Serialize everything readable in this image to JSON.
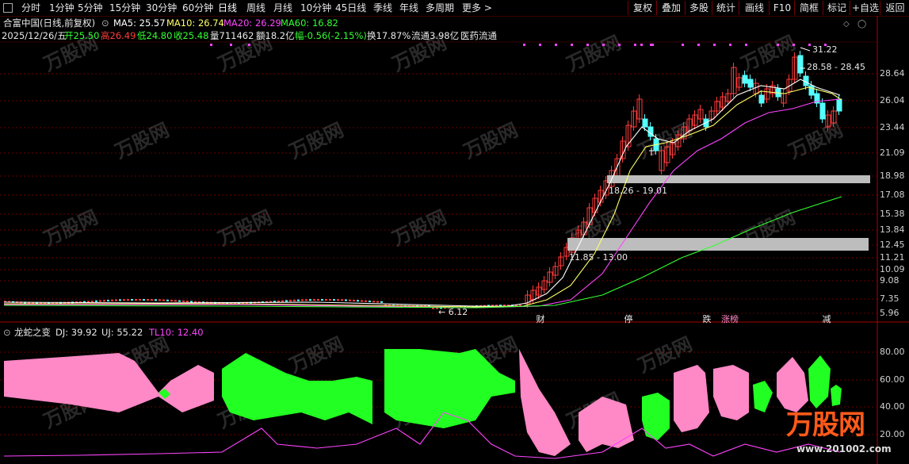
{
  "toolbar": {
    "left_items": [
      "分时",
      "1分钟",
      "5分钟",
      "15分钟",
      "30分钟",
      "60分钟",
      "日线",
      "周线",
      "月线",
      "10分钟",
      "45日线",
      "季线",
      "年线",
      "多周期",
      "更多 >"
    ],
    "active_item": "日线",
    "right_items": [
      "复权",
      "叠加",
      "多股",
      "统计",
      "画线",
      "F10",
      "简框",
      "标记",
      "+自选",
      "返回"
    ]
  },
  "stock": {
    "name_line": "合富中国(日线,前复权)",
    "ma5": "MA5: 25.57",
    "ma10": "MA10: 26.74",
    "ma20": "MA20: 26.29",
    "ma60": "MA60: 16.82",
    "date": "2025/12/26/五",
    "open": "开25.50",
    "high": "高26.49",
    "low": "低24.80",
    "close": "收25.48",
    "volume": "量711462",
    "amount": "额18.2亿",
    "change": "幅-0.56(-2.15%)",
    "turnover": "换17.87%",
    "float": "流通3.98亿",
    "sector": "医药流通"
  },
  "annotations": {
    "peak": "31.22",
    "range_top": "28.58 - 28.45",
    "box_upper": "18.26 - 19.01",
    "box_lower": "11.85 - 13.00",
    "low_mark": "← 6.12"
  },
  "events": [
    "财",
    "停",
    "跌",
    "涨榜",
    "减"
  ],
  "main_axis": [
    "28.64",
    "26.04",
    "23.44",
    "21.09",
    "18.98",
    "17.08",
    "15.38",
    "13.84",
    "12.45",
    "11.21",
    "10.09",
    "9.08",
    "7.35",
    "5.96"
  ],
  "indicator": {
    "name": "龙蛇之变",
    "dj": "DJ: 39.92",
    "uj": "UJ: 55.22",
    "tl10": "TL10: 12.40",
    "axis": [
      "80.00",
      "60.00",
      "40.00",
      "20.00"
    ]
  },
  "watermark": {
    "brand": "万股网",
    "url": "www.201002.com"
  },
  "colors": {
    "up": "#ff3b3b",
    "down": "#54ffff",
    "ma5": "#ffffff",
    "ma10": "#ffff66",
    "ma20": "#ff44ff",
    "ma60": "#33ff33",
    "pink": "#ff88c6",
    "green": "#22ff22",
    "grid": "#660000"
  }
}
